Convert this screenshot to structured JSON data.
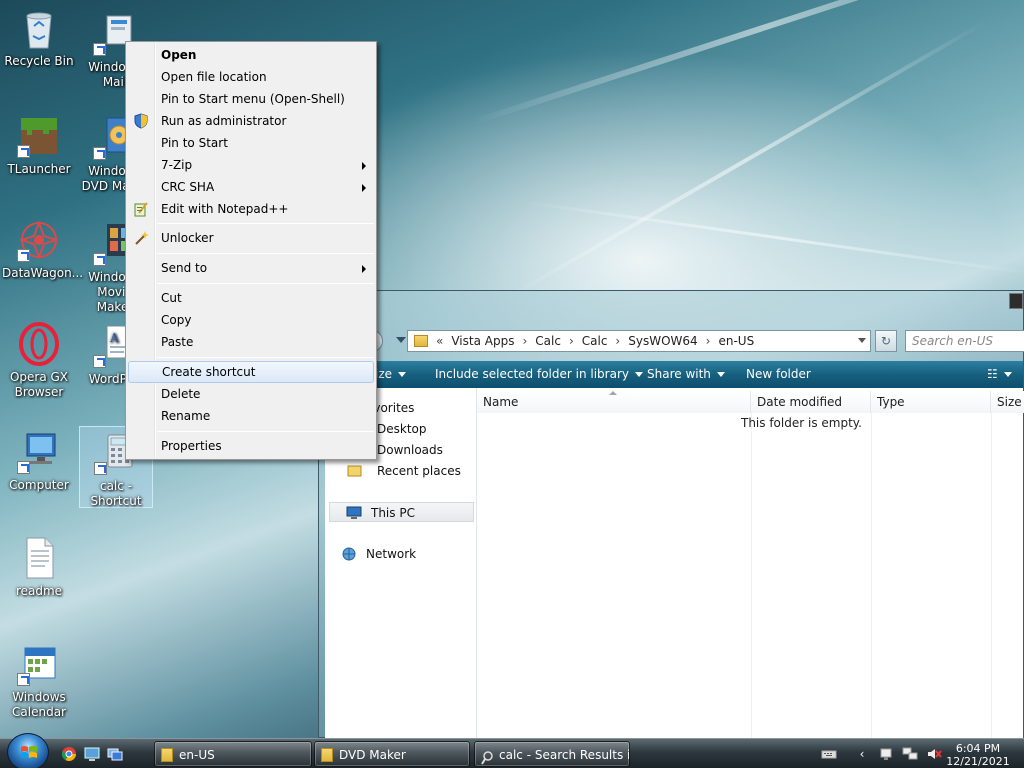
{
  "desktop": {
    "icons": [
      {
        "label": "Recycle Bin"
      },
      {
        "label": "Windows Mail"
      },
      {
        "label": "TLauncher"
      },
      {
        "label": "Windows DVD Maker"
      },
      {
        "label": "DataWagon..."
      },
      {
        "label": "Windows Movie Maker"
      },
      {
        "label": "Opera GX Browser"
      },
      {
        "label": "WordPad"
      },
      {
        "label": "Computer"
      },
      {
        "label": "calc - Shortcut"
      },
      {
        "label": "readme"
      },
      {
        "label": "Windows Calendar"
      }
    ]
  },
  "context_menu": {
    "items": [
      {
        "label": "Open"
      },
      {
        "label": "Open file location"
      },
      {
        "label": "Pin to Start menu (Open-Shell)"
      },
      {
        "label": "Run as administrator"
      },
      {
        "label": "Pin to Start"
      },
      {
        "label": "7-Zip"
      },
      {
        "label": "CRC SHA"
      },
      {
        "label": "Edit with Notepad++"
      },
      {
        "label": "Unlocker"
      },
      {
        "label": "Send to"
      },
      {
        "label": "Cut"
      },
      {
        "label": "Copy"
      },
      {
        "label": "Paste"
      },
      {
        "label": "Create shortcut"
      },
      {
        "label": "Delete"
      },
      {
        "label": "Rename"
      },
      {
        "label": "Properties"
      }
    ]
  },
  "explorer": {
    "address": {
      "prefix": "«",
      "crumbs": [
        "Vista Apps",
        "Calc",
        "Calc",
        "SysWOW64",
        "en-US"
      ]
    },
    "search_placeholder": "Search en-US",
    "commands": {
      "organize_fragment": "ize",
      "include": "Include selected folder in library",
      "share": "Share with",
      "new_folder": "New folder"
    },
    "nav": {
      "favorites_fragment": "avorites",
      "desktop": "Desktop",
      "downloads": "Downloads",
      "recent": "Recent places",
      "this_pc": "This PC",
      "network": "Network"
    },
    "columns": {
      "name": "Name",
      "date": "Date modified",
      "type": "Type",
      "size": "Size"
    },
    "empty_message": "This folder is empty."
  },
  "taskbar": {
    "buttons": [
      {
        "label": "en-US"
      },
      {
        "label": "DVD Maker"
      },
      {
        "label": "calc - Search Results in ..."
      }
    ],
    "clock": {
      "time": "6:04 PM",
      "date": "12/21/2021"
    }
  }
}
